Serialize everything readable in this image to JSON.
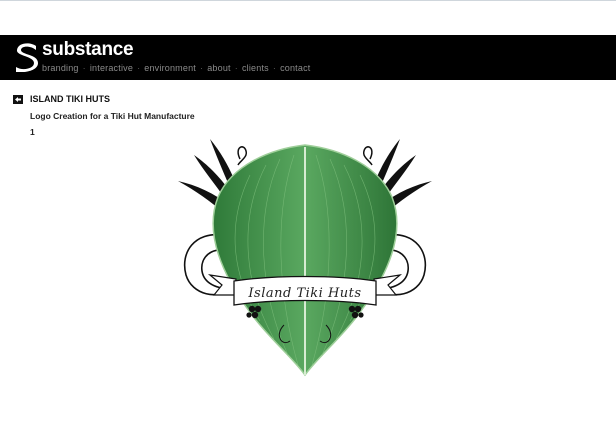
{
  "brand": {
    "name": "substance"
  },
  "nav": {
    "items": [
      "branding",
      "interactive",
      "environment",
      "about",
      "clients",
      "contact"
    ],
    "separator": "·"
  },
  "project": {
    "title": "ISLAND TIKI HUTS",
    "subtitle": "Logo Creation for a Tiki Hut Manufacture",
    "page": "1"
  },
  "emblem": {
    "banner_text": "Island Tiki Huts"
  },
  "colors": {
    "header_bg": "#000000",
    "leaf_green": "#3f8f48",
    "nav_text": "#8a8a8a"
  },
  "icons": {
    "back": "back-arrow-icon",
    "logo": "substance-s-logo"
  }
}
